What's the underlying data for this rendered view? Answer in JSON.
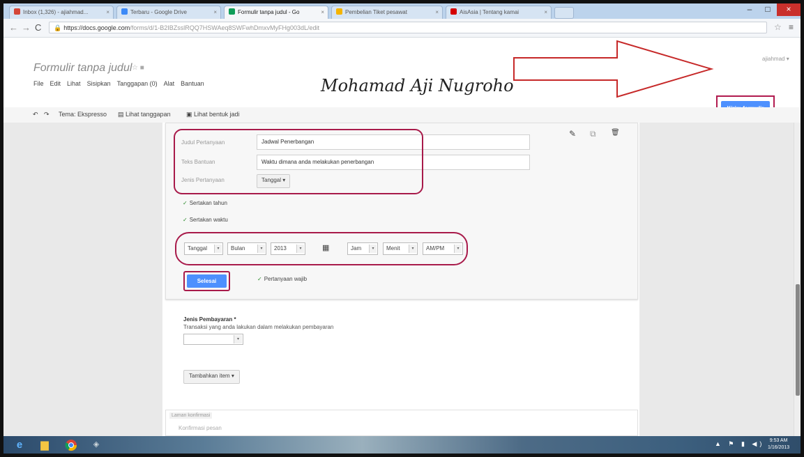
{
  "browser": {
    "tabs": [
      {
        "label": "Inbox (1,326) - ajiahmad...",
        "color": "#d44638",
        "active": false
      },
      {
        "label": "Terbaru - Google Drive",
        "color": "#3d8af7",
        "active": false
      },
      {
        "label": "Formulir tanpa judul - Go",
        "color": "#0f9d58",
        "active": true
      },
      {
        "label": "Pembelian Tiket pesawat",
        "color": "#f4b400",
        "active": false
      },
      {
        "label": "AisAsia | Tentang kamai",
        "color": "#d50000",
        "active": false
      }
    ],
    "tab_close": "×",
    "url_host": "https://docs.google.com",
    "url_path": "/forms/d/1-B2IBZsslRQQ7HSWAeq8SWFwhDmxvMyFHg003dL/edit",
    "min": "–",
    "max": "□",
    "close": "×"
  },
  "header": {
    "form_title": "Formulir tanpa judul",
    "title_icons": "☆ ■",
    "menu": [
      "File",
      "Edit",
      "Lihat",
      "Sisipkan",
      "Tanggapan (0)",
      "Alat",
      "Bantuan"
    ],
    "signature": "Mohamad Aji Nugroho",
    "user": "ajiahmad ▾",
    "send_label": "Kirim formulir"
  },
  "subtoolbar": {
    "undo": "↶",
    "redo": "↷",
    "theme": "Tema: Ekspresso",
    "responses": "Lihat tanggapan",
    "live_form": "Lihat bentuk jadi"
  },
  "question": {
    "title_label": "Judul Pertanyaan",
    "title_value": "Jadwal Penerbangan",
    "help_label": "Teks Bantuan",
    "help_value": "Waktu dimana anda melakukan penerbangan",
    "type_label": "Jenis Pertanyaan",
    "type_value": "Tanggal ▾",
    "tools": [
      "✎",
      "⧉",
      "🗑"
    ],
    "include_year": "Sertakan tahun",
    "include_time": "Sertakan waktu",
    "checkmark": "✓",
    "date_fields": [
      "Tanggal",
      "Bulan",
      "2013",
      "Jam",
      "Menit",
      "AM/PM"
    ],
    "calendar_icon": "▦",
    "dropdown_glyph": "▾",
    "done_label": "Selesai",
    "required_label": "Pertanyaan wajib"
  },
  "question2": {
    "title": "Jenis Pembayaran *",
    "help": "Transaksi yang anda lakukan dalam melakukan pembayaran"
  },
  "add_item": "Tambahkan item ▾",
  "confirm": {
    "label": "Laman konfirmasi",
    "message": "Konfirmasi pesan"
  },
  "taskbar": {
    "tray": "▲ ⚑ ▮ ◀)",
    "time": "9:53 AM",
    "date": "1/16/2013"
  },
  "colors": {
    "accent_blue": "#4d90fe",
    "annotation": "#a81a4a"
  }
}
